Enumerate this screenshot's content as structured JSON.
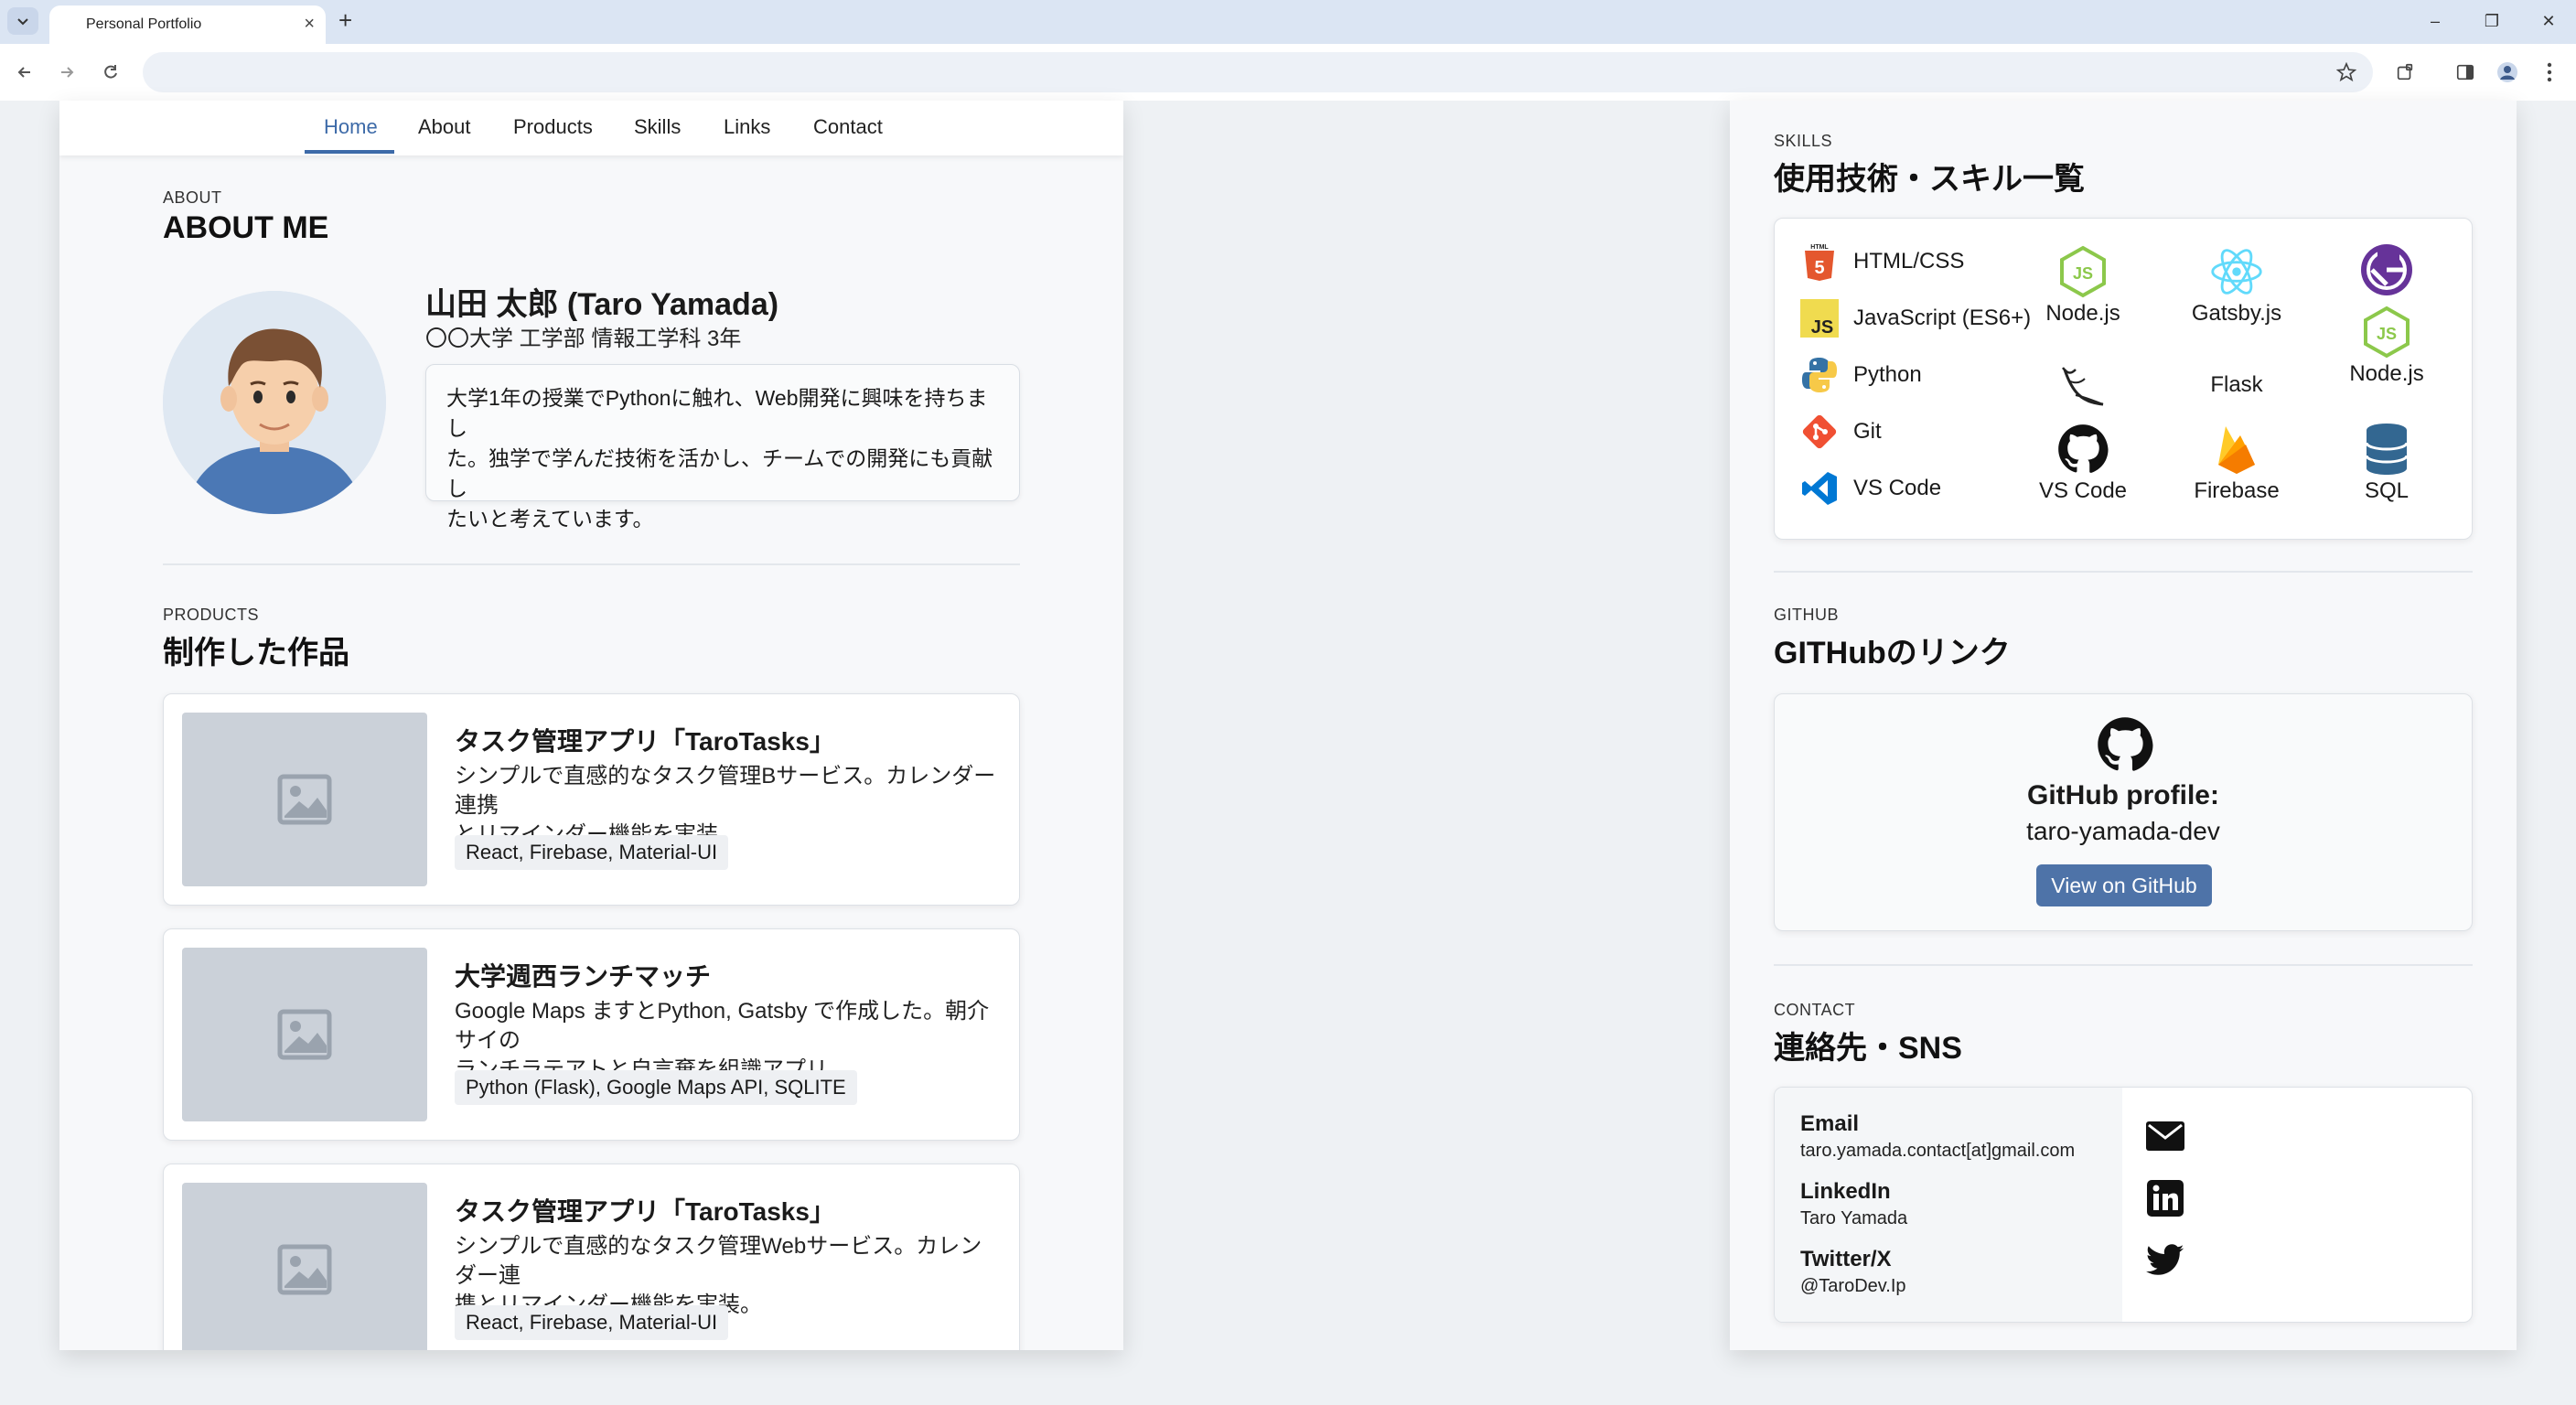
{
  "browser": {
    "tab_title": "Personal Portfolio",
    "tab_close": "×",
    "new_tab": "+",
    "minimize": "–",
    "restore": "❐",
    "close": "✕"
  },
  "nav": {
    "items": [
      "Home",
      "About",
      "Products",
      "Skills",
      "Links",
      "Contact"
    ],
    "active": "Home"
  },
  "about": {
    "eyebrow": "ABOUT",
    "title": "ABOUT ME",
    "name": "山田 太郎 (Taro Yamada)",
    "school": "〇〇大学 工学部 情報工学科 3年",
    "bio_lines": [
      "大学1年の授業でPythonに触れ、Web開発に興味を持ちまし",
      "た。独学で学んだ技術を活かし、チームでの開発にも貢献し",
      "たいと考えています。"
    ]
  },
  "products": {
    "eyebrow": "PRODUCTS",
    "title": "制作した作品",
    "items": [
      {
        "title": "タスク管理アプリ「TaroTasks」",
        "desc": [
          "シンプルで直感的なタスク管理Bサービス。カレンダー連携",
          "とリマインダー機能を実装。"
        ],
        "tags": "React, Firebase, Material-UI"
      },
      {
        "title": "大学週西ランチマッチ",
        "desc": [
          "Google Maps ますとPython, Gatsby で作成した。朝介サイの",
          "ランチラテアトと自言棄を組識アプリ ...."
        ],
        "tags": "Python (Flask), Google Maps API, SQLITE"
      },
      {
        "title": "タスク管理アプリ「TaroTasks」",
        "desc": [
          "シンプルで直感的なタスク管理Webサービス。カレンダー連",
          "携とリマインダー機能を実装。"
        ],
        "tags": "React, Firebase, Material-UI"
      }
    ]
  },
  "skills": {
    "eyebrow": "SKILLS",
    "title": "使用技術・スキル一覧",
    "list": [
      "HTML/CSS",
      "JavaScript (ES6+)",
      "Python",
      "Git",
      "VS Code"
    ],
    "grid": {
      "c1": [
        "Node.js",
        "VS Code"
      ],
      "c2": [
        "Gatsby.js",
        "Flask",
        "Firebase"
      ],
      "c3": [
        "Node.js",
        "SQL"
      ]
    },
    "colors": {
      "html": "#e4572e",
      "js": "#f0db4f",
      "python_blue": "#3572A5",
      "python_yellow": "#f7c948",
      "git": "#f05033",
      "vscode": "#0078d4",
      "node": "#8cc84b",
      "react": "#61dafb",
      "gatsby": "#663399",
      "firebase": "#ffa000",
      "sql": "#336791"
    }
  },
  "github": {
    "eyebrow": "GITHUB",
    "title": "GITHubのリンク",
    "profile_label": "GitHub profile:",
    "username": "taro-yamada-dev",
    "button": "View on GitHub"
  },
  "contact": {
    "eyebrow": "CONTACT",
    "title": "連絡先・SNS",
    "items": [
      {
        "label": "Email",
        "value": "taro.yamada.contact[at]gmail.com",
        "icon": "mail-icon"
      },
      {
        "label": "LinkedIn",
        "value": "Taro Yamada",
        "icon": "linkedin-icon"
      },
      {
        "label": "Twitter/X",
        "value": "@TaroDev.Ip",
        "icon": "twitter-icon"
      }
    ]
  }
}
